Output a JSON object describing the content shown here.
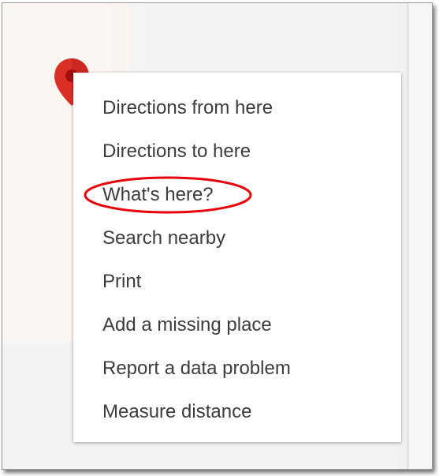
{
  "context_menu": {
    "items": [
      {
        "label": "Directions from here"
      },
      {
        "label": "Directions to here"
      },
      {
        "label": "What's here?"
      },
      {
        "label": "Search nearby"
      },
      {
        "label": "Print"
      },
      {
        "label": "Add a missing place"
      },
      {
        "label": "Report a data problem"
      },
      {
        "label": "Measure distance"
      }
    ]
  },
  "map_pin": {
    "icon": "map-pin-icon",
    "color": "#d93025"
  },
  "annotation": {
    "color": "#e8000b",
    "target": "What's here?"
  }
}
